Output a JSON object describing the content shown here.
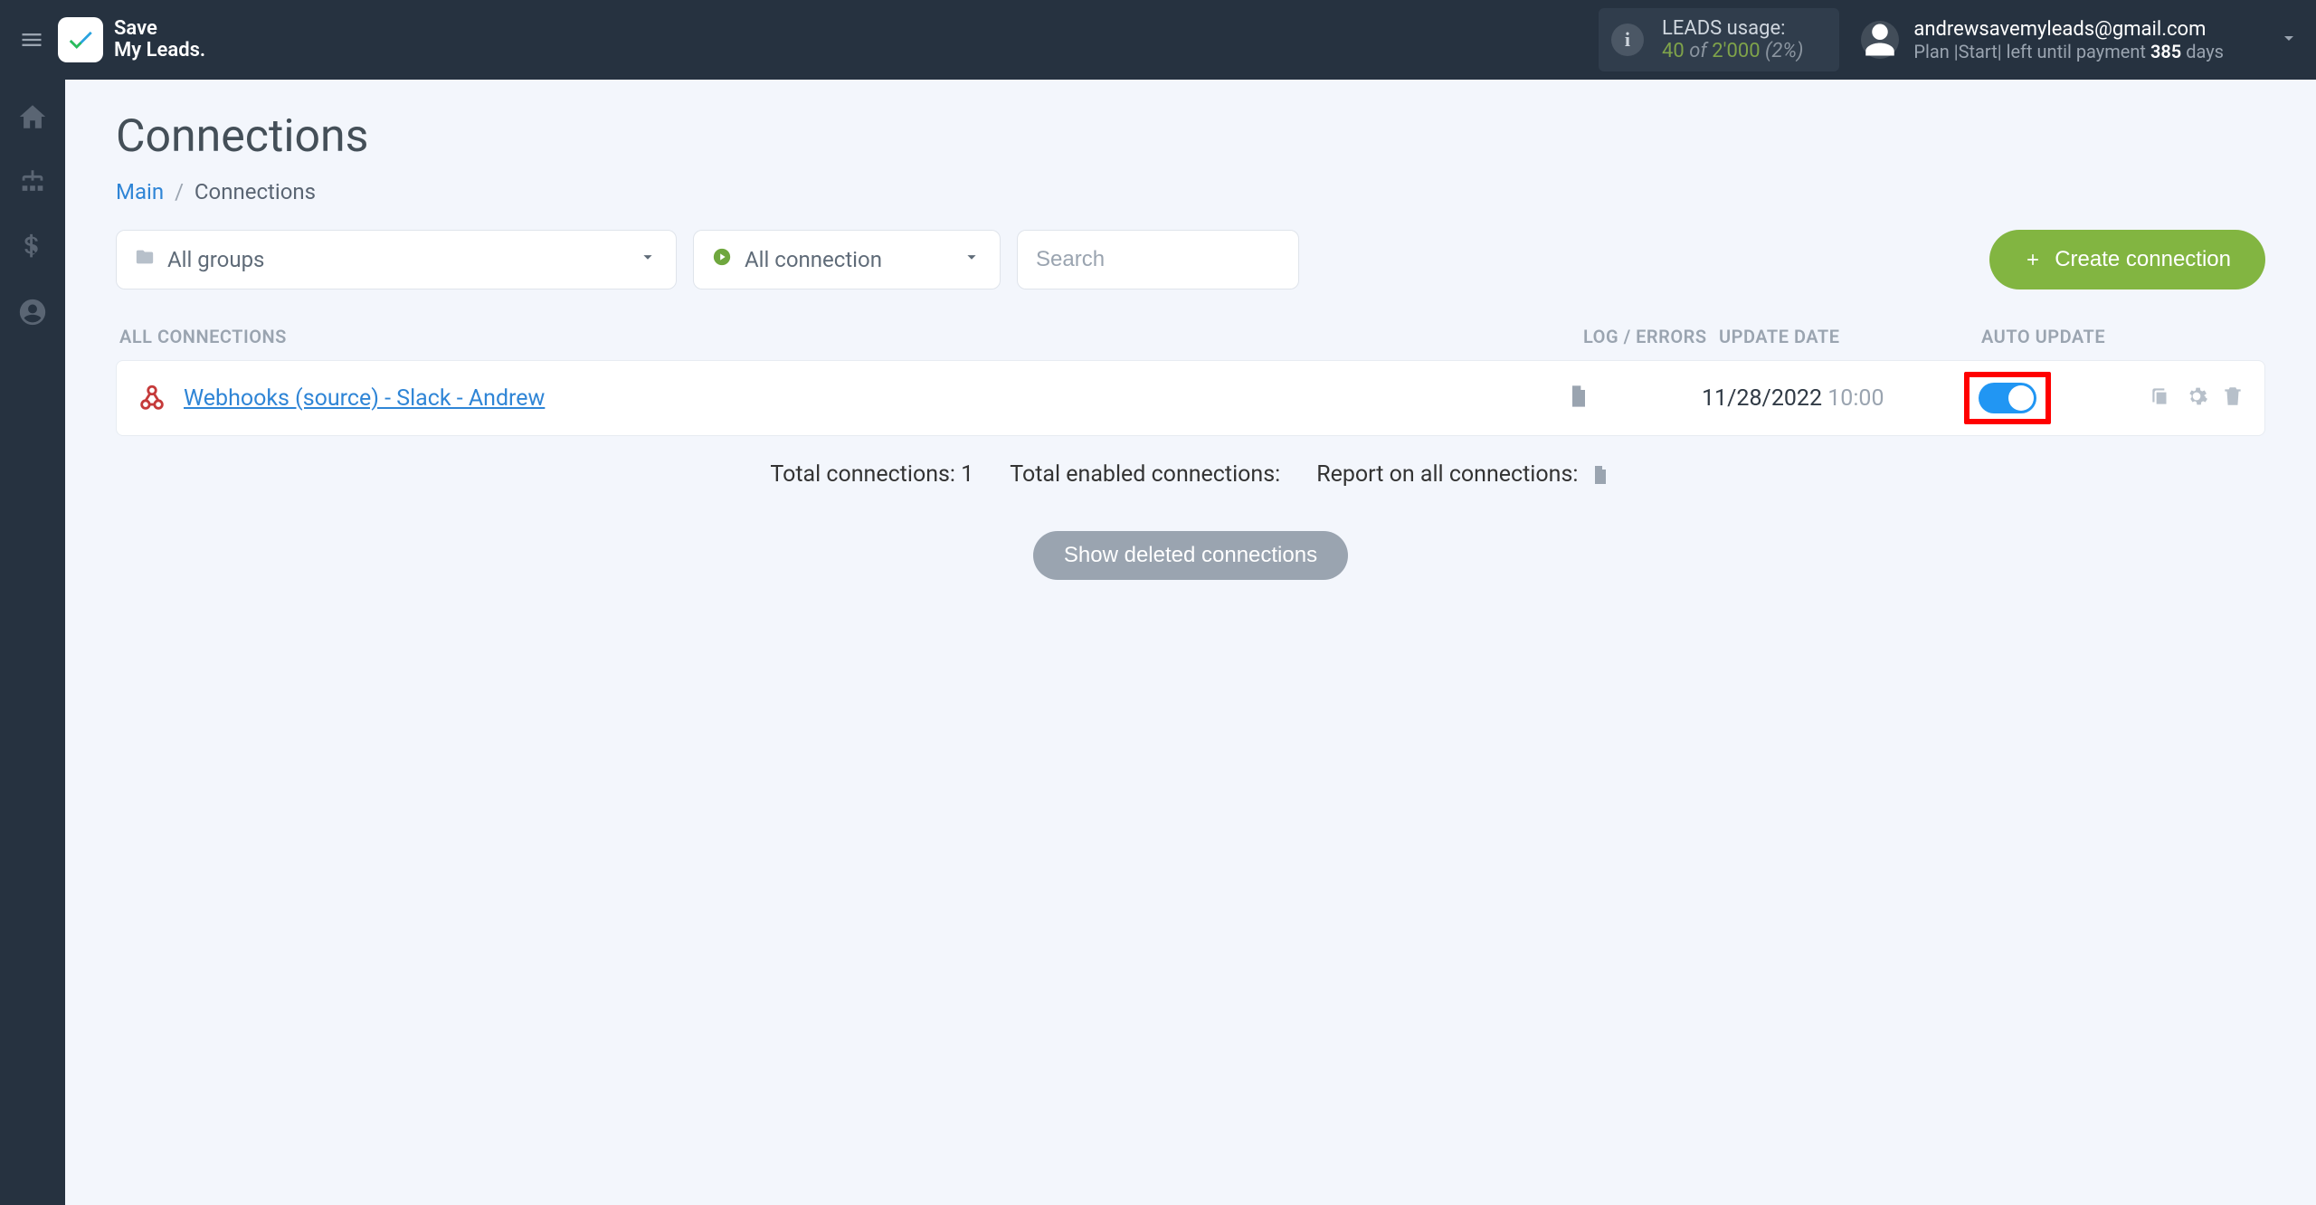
{
  "header": {
    "brand_line1": "Save",
    "brand_line2": "My Leads.",
    "usage_label": "LEADS usage:",
    "usage_current": "40",
    "usage_of": "of",
    "usage_total": "2'000",
    "usage_pct": "(2%)",
    "account_email": "andrewsavemyleads@gmail.com",
    "plan_prefix": "Plan |Start| left until payment",
    "plan_days_num": "385",
    "plan_days_word": "days"
  },
  "page": {
    "title": "Connections",
    "breadcrumb_main": "Main",
    "breadcrumb_current": "Connections"
  },
  "filters": {
    "groups_label": "All groups",
    "connections_label": "All connection",
    "search_placeholder": "Search",
    "create_label": "Create connection"
  },
  "columns": {
    "all_connections": "ALL CONNECTIONS",
    "log_errors": "LOG / ERRORS",
    "update_date": "UPDATE DATE",
    "auto_update": "AUTO UPDATE"
  },
  "rows": [
    {
      "name": "Webhooks (source) - Slack - Andrew",
      "date": "11/28/2022",
      "time": "10:00",
      "auto_update_on": true
    }
  ],
  "summary": {
    "total_label": "Total connections:",
    "total_value": "1",
    "enabled_label": "Total enabled connections:",
    "report_label": "Report on all connections:"
  },
  "deleted_button": "Show deleted connections"
}
